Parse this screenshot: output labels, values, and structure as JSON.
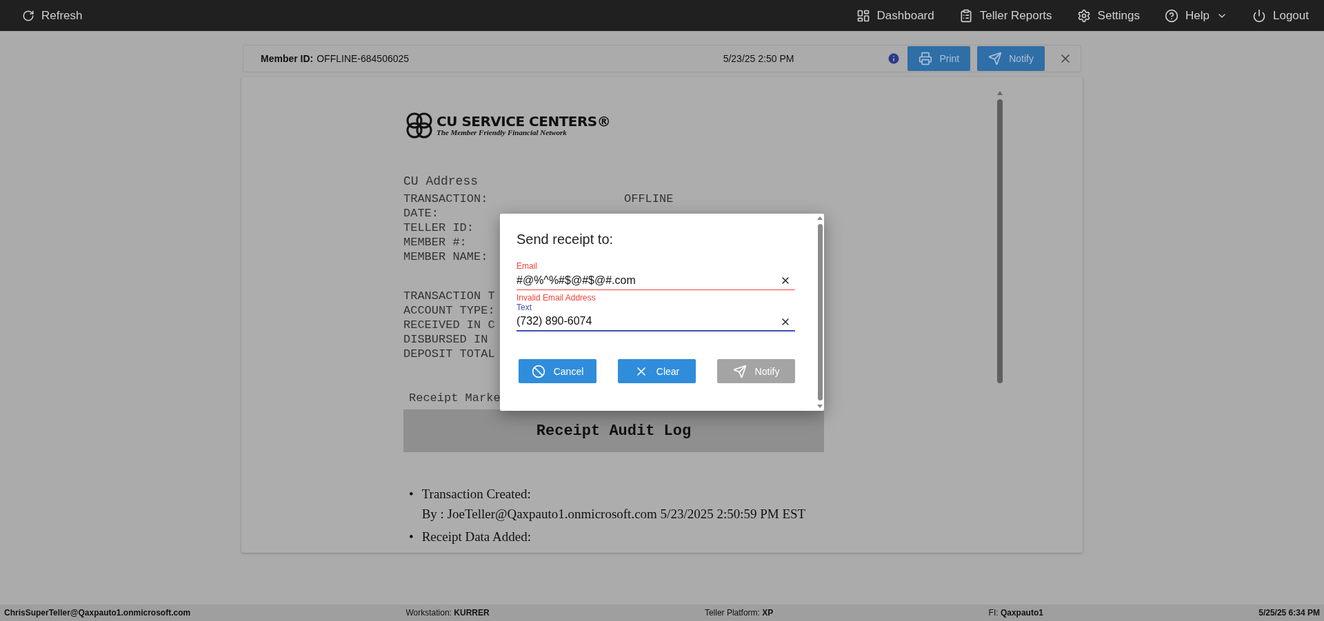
{
  "top_bar": {
    "refresh": "Refresh",
    "items": [
      {
        "label": "Dashboard",
        "kind": "dashboard"
      },
      {
        "label": "Teller Reports",
        "kind": "reports"
      },
      {
        "label": "Settings",
        "kind": "settings"
      },
      {
        "label": "Help",
        "kind": "help"
      },
      {
        "label": "Logout",
        "kind": "logout"
      }
    ]
  },
  "header": {
    "member_id_label": "Member ID:",
    "member_id": "OFFLINE-684506025",
    "timestamp": "5/23/25 2:50 PM",
    "buttons": [
      {
        "label": "Print",
        "kind": "print"
      },
      {
        "label": "Notify",
        "kind": "notify"
      }
    ]
  },
  "receipt": {
    "logo": {
      "name": "CU SERVICE CENTERS®",
      "tagline": "The Member Friendly Financial Network"
    },
    "address": "CU Address",
    "fields": [
      {
        "label": "TRANSACTION:",
        "value": "OFFLINE"
      },
      {
        "label": "DATE:"
      },
      {
        "label": "TELLER ID:"
      },
      {
        "label": "MEMBER #:"
      },
      {
        "label": "MEMBER NAME:"
      }
    ],
    "fields_2": [
      {
        "label": "TRANSACTION T"
      },
      {
        "label": "ACCOUNT TYPE:"
      },
      {
        "label": "RECEIVED IN C"
      },
      {
        "label": "DISBURSED IN"
      },
      {
        "label": "DEPOSIT TOTAL"
      }
    ],
    "marketing": "Receipt Marke",
    "audit_title": "Receipt Audit Log",
    "audit_entries": [
      {
        "marker": "•",
        "title": "Transaction Created:",
        "detail": "By : JoeTeller@Qaxpauto1.onmicrosoft.com 5/23/2025 2:50:59 PM EST"
      },
      {
        "marker": "•",
        "title": "Receipt Data Added:"
      }
    ]
  },
  "dialog": {
    "title": "Send receipt to:",
    "fields": [
      {
        "label": "Email",
        "value": "#@%^%#$@#$@#.com",
        "error": "Invalid Email Address",
        "focused": false
      },
      {
        "label": "Text",
        "value": "(732) 890-6074",
        "focused": true
      }
    ],
    "buttons": [
      {
        "label": "Cancel",
        "kind": "cancel",
        "disabled": false
      },
      {
        "label": "Clear",
        "kind": "clear",
        "disabled": false
      },
      {
        "label": "Notify",
        "kind": "notify",
        "disabled": true
      }
    ]
  },
  "status_bar": [
    {
      "value": "ChrisSuperTeller@Qaxpauto1.onmicrosoft.com"
    },
    {
      "label": "Workstation:",
      "value": "KURRER"
    },
    {
      "label": "Teller Platform:",
      "value": "XP"
    },
    {
      "label": "FI:",
      "value": "Qaxpauto1"
    },
    {
      "value": "5/25/25 6:34 PM"
    }
  ]
}
